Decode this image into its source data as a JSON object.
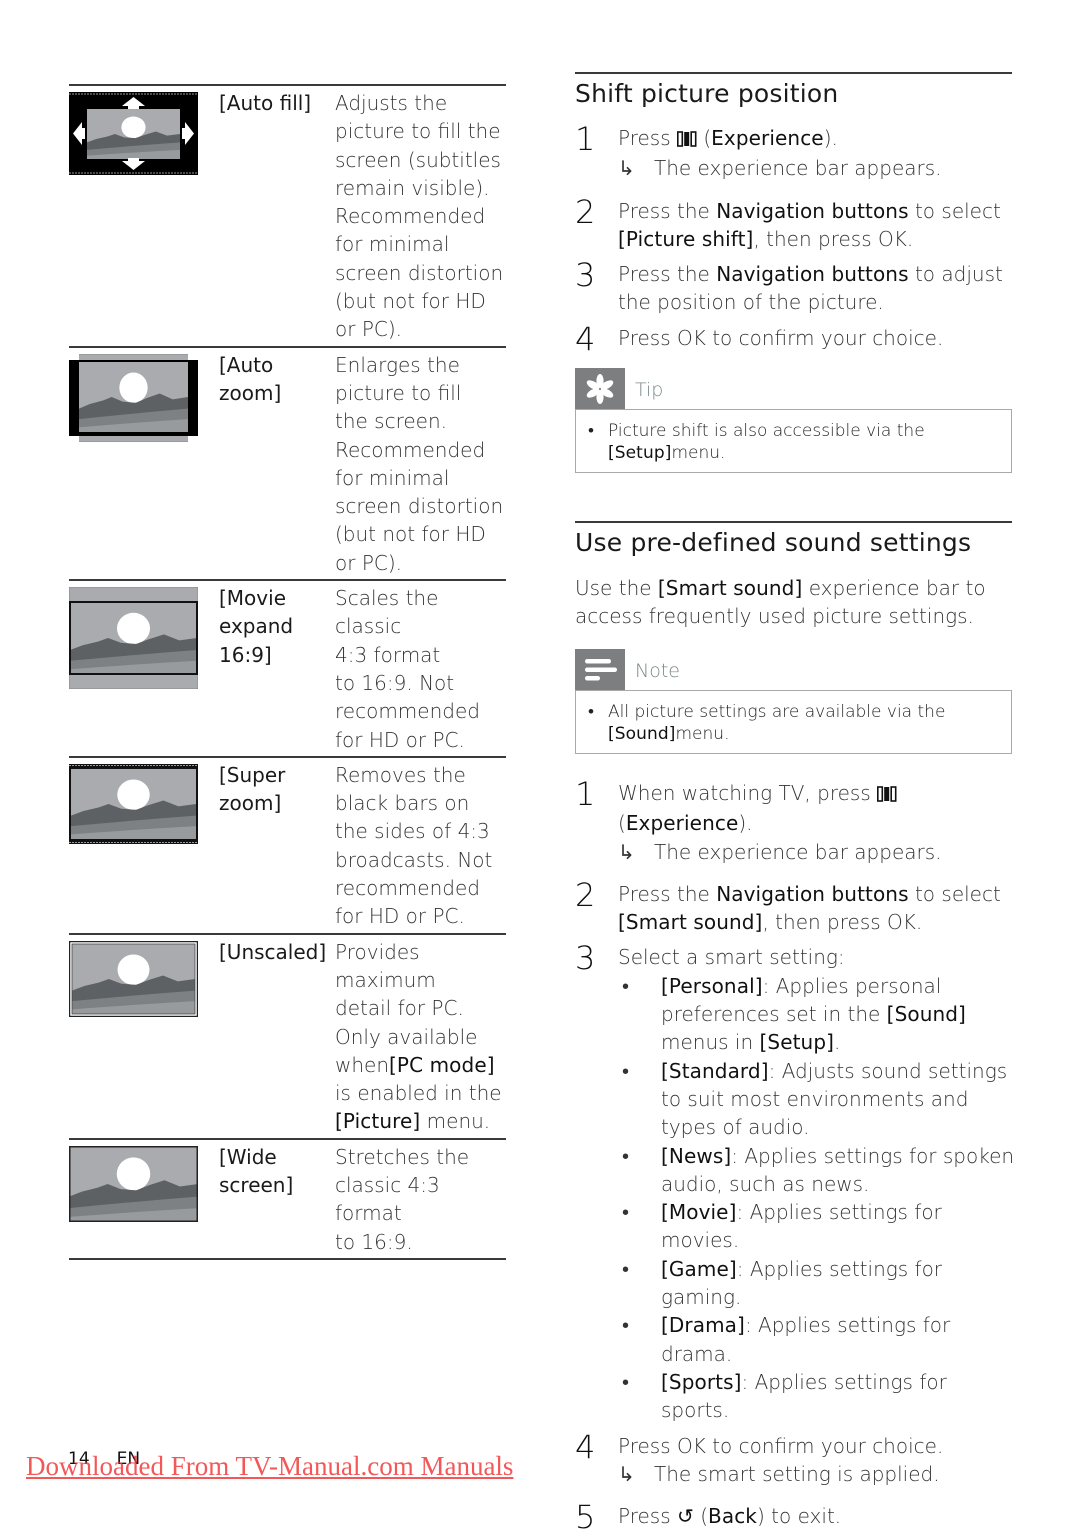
{
  "left_table": {
    "rows": [
      {
        "icon": "auto-fill-screen-icon",
        "name": "[Auto fill]",
        "desc_lines": [
          "Adjusts the",
          "picture to fill the",
          "screen (subtitles",
          "remain visible).",
          "Recommended",
          "for minimal",
          "screen distortion",
          "(but not for HD",
          "or PC)."
        ]
      },
      {
        "icon": "auto-zoom-screen-icon",
        "name_lines": [
          "[Auto",
          "zoom]"
        ],
        "desc_lines": [
          "Enlarges the",
          "picture to fill",
          "the screen.",
          "Recommended",
          "for minimal",
          "screen distortion",
          "(but not for HD",
          "or PC)."
        ]
      },
      {
        "icon": "movie-expand-screen-icon",
        "name_lines": [
          "[Movie",
          "expand",
          "16:9]"
        ],
        "desc_lines": [
          "Scales the classic",
          "4:3 format",
          "to 16:9. Not",
          "recommended",
          "for HD or PC."
        ]
      },
      {
        "icon": "super-zoom-screen-icon",
        "name_lines": [
          "[Super",
          "zoom]"
        ],
        "desc_lines": [
          "Removes the",
          "black bars on",
          "the sides of 4:3",
          "broadcasts. Not",
          "recommended",
          "for HD or PC."
        ]
      },
      {
        "icon": "unscaled-screen-icon",
        "name_lines": [
          "[Unscaled]"
        ],
        "desc_lines": [
          "Provides",
          "maximum",
          "detail for PC.",
          "Only available",
          "when",
          "[PC mode]",
          "is enabled in the",
          "[Picture]",
          " menu."
        ]
      },
      {
        "icon": "wide-screen-icon",
        "name_lines": [
          "[Wide",
          "screen]"
        ],
        "desc_lines": [
          "Stretches the",
          "classic 4:3 format",
          "to 16:9."
        ]
      }
    ]
  },
  "shift_section": {
    "title": "Shift picture position",
    "steps": [
      {
        "num": "1",
        "parts": [
          "Press ",
          "(Experience)",
          "."
        ],
        "bold": "Experience",
        "result": "The experience bar appears."
      },
      {
        "num": "2",
        "text1": "Press the ",
        "bold1": "Navigation buttons",
        "text2": " to select",
        "bold2": "[Picture shift]",
        "text3": ", then press OK."
      },
      {
        "num": "3",
        "text1": "Press the ",
        "bold1": "Navigation buttons",
        "text2": " to adjust",
        "line2": "the position of the picture."
      },
      {
        "num": "4",
        "text": "Press OK to confirm your choice."
      }
    ],
    "tip": {
      "label": "Tip",
      "text": "Picture shift is also accessible via the",
      "bold": "[Setup]",
      "after": "menu."
    }
  },
  "sound_section": {
    "title": "Use pre-defined sound settings",
    "intro_before": "Use the ",
    "intro_bold": "[Smart sound]",
    "intro_after": " experience bar to",
    "intro_line2": "access frequently used picture settings.",
    "note": {
      "label": "Note",
      "text": "All picture settings are available via the",
      "bold": "[Sound]",
      "after": "menu."
    },
    "steps": [
      {
        "num": "1",
        "text": "When watching TV, press ",
        "line2_open": "(",
        "bold": "Experience",
        "line2_close": ").",
        "result": "The experience bar appears."
      },
      {
        "num": "2",
        "text1": "Press the ",
        "bold1": "Navigation buttons",
        "text2": " to select",
        "bold2": "[Smart sound]",
        "text3": ", then press OK."
      },
      {
        "num": "3",
        "text": "Select a smart setting:",
        "options": [
          {
            "name": "[Personal]",
            "desc": ": Applies personal preferences set in the ",
            "bold2": "[Sound]",
            "desc2": " menus in ",
            "bold3": "[Setup]",
            "desc3": "."
          },
          {
            "name": "[Standard]",
            "desc": ": Adjusts sound settings to suit most environments and types of audio."
          },
          {
            "name": "[News]",
            "desc": ": Applies settings for spoken audio, such as news."
          },
          {
            "name": "[Movie]",
            "desc": ": Applies settings for movies."
          },
          {
            "name": "[Game]",
            "desc": ": Applies settings for gaming."
          },
          {
            "name": "[Drama]",
            "desc": ": Applies settings for drama."
          },
          {
            "name": "[Sports]",
            "desc": ": Applies settings for sports."
          }
        ]
      },
      {
        "num": "4",
        "text": "Press OK to confirm your choice.",
        "result": "The smart setting is applied."
      },
      {
        "num": "5",
        "before": "Press ",
        "bold": "Back",
        "after": " to exit."
      }
    ]
  },
  "footer": {
    "page_number": "14",
    "language": "EN",
    "watermark_link": "Downloaded From TV-Manual.com Manuals"
  },
  "symbols": {
    "result_arrow": "↳",
    "bullet": "•",
    "back": "↺"
  }
}
